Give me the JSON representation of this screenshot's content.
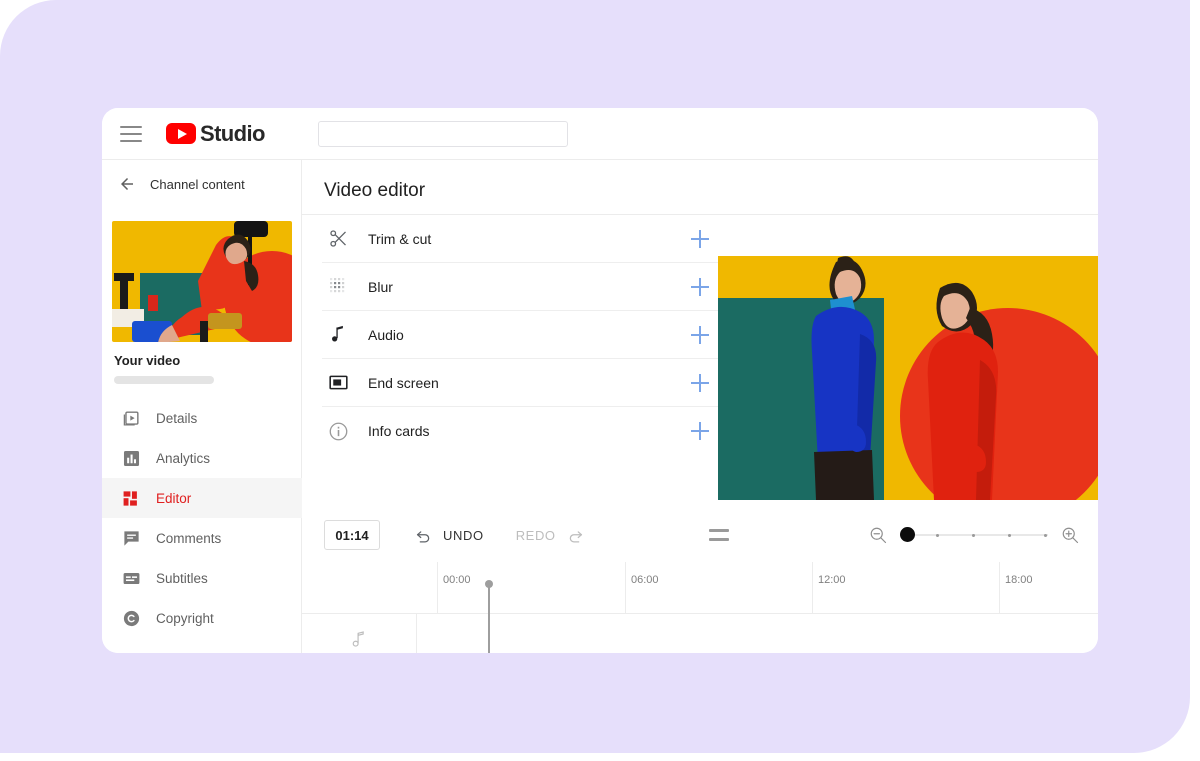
{
  "header": {
    "menu_icon": "hamburger-icon",
    "logo_text": "Studio",
    "search_value": "",
    "search_placeholder": ""
  },
  "sidebar": {
    "back_label": "Channel content",
    "video_title": "Your video",
    "items": [
      {
        "label": "Details",
        "icon": "details-icon",
        "active": false
      },
      {
        "label": "Analytics",
        "icon": "analytics-icon",
        "active": false
      },
      {
        "label": "Editor",
        "icon": "editor-icon",
        "active": true
      },
      {
        "label": "Comments",
        "icon": "comments-icon",
        "active": false
      },
      {
        "label": "Subtitles",
        "icon": "subtitles-icon",
        "active": false
      },
      {
        "label": "Copyright",
        "icon": "copyright-icon",
        "active": false
      }
    ]
  },
  "main": {
    "page_title": "Video editor",
    "tools": [
      {
        "label": "Trim & cut",
        "icon": "scissors-icon",
        "add": "+"
      },
      {
        "label": "Blur",
        "icon": "blur-dots-icon",
        "add": "+"
      },
      {
        "label": "Audio",
        "icon": "music-note-icon",
        "add": "+"
      },
      {
        "label": "End screen",
        "icon": "end-screen-icon",
        "add": "+"
      },
      {
        "label": "Info cards",
        "icon": "info-circle-icon",
        "add": "+"
      }
    ],
    "toolbar": {
      "timecode": "01:14",
      "undo_label": "UNDO",
      "redo_label": "REDO",
      "redo_disabled": true,
      "split_icon": "equals-icon",
      "zoom_out_icon": "zoom-out-icon",
      "zoom_in_icon": "zoom-in-icon",
      "zoom_level": 0
    },
    "timeline": {
      "ruler_labels": [
        "00:00",
        "06:00",
        "12:00",
        "18:00"
      ],
      "playhead_position": "01:14",
      "tracks": [
        {
          "name": "audio-track",
          "icon": "music-note-icon",
          "has_clip": false
        },
        {
          "name": "video-track",
          "icon": "video-camera-icon",
          "has_clip": true
        }
      ]
    }
  },
  "colors": {
    "background": "#E6DFFB",
    "brand_red": "#FF0000",
    "active_red": "#E02020",
    "accent_blue": "#7BA5E8",
    "preview_yellow": "#F0B800",
    "preview_teal": "#1B6B62",
    "preview_red": "#E8341A",
    "preview_blue": "#1734C4"
  }
}
